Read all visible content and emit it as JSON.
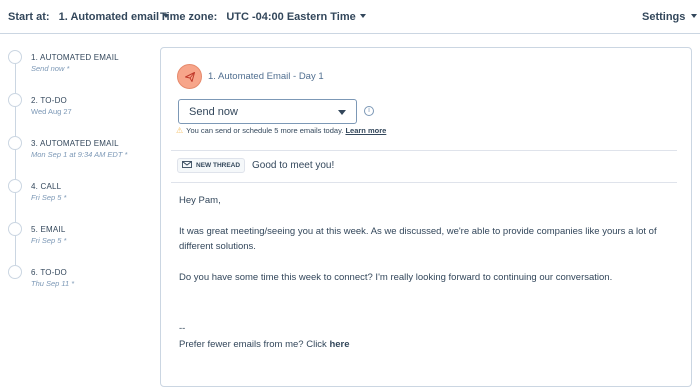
{
  "topbar": {
    "start_at_label": "Start at:",
    "start_at_value": "1. Automated email",
    "timezone_label": "Time zone:",
    "timezone_value": "UTC -04:00 Eastern Time",
    "settings_label": "Settings"
  },
  "steps": [
    {
      "title": "1. AUTOMATED EMAIL",
      "subtitle": "Send now *"
    },
    {
      "title": "2. TO-DO",
      "subtitle": "Wed Aug 27"
    },
    {
      "title": "3. AUTOMATED EMAIL",
      "subtitle": "Mon Sep 1 at 9:34 AM EDT *"
    },
    {
      "title": "4. CALL",
      "subtitle": "Fri Sep 5 *"
    },
    {
      "title": "5. EMAIL",
      "subtitle": "Fri Sep 5 *"
    },
    {
      "title": "6. TO-DO",
      "subtitle": "Thu Sep 11 *"
    }
  ],
  "card": {
    "title": "1. Automated Email - Day 1",
    "send_option": "Send now",
    "warning_text": "You can send or schedule 5 more emails today.",
    "learn_more": "Learn more",
    "thread_badge": "NEW THREAD",
    "subject": "Good to meet you!",
    "greeting": "Hey Pam,",
    "paragraph1": "It was great meeting/seeing you at  this week. As we discussed, we're able to provide companies like yours a lot of different solutions.",
    "paragraph2": "Do you have some time this week to connect? I'm really looking forward to continuing our conversation.",
    "signoff": "--",
    "unsubscribe_text": "Prefer fewer emails from me? Click",
    "unsubscribe_link": "here"
  },
  "icons": {
    "send": "paper-plane-icon",
    "info": "info-icon",
    "warning": "warning-icon",
    "email": "envelope-icon"
  },
  "colors": {
    "accent": "#f7a58a",
    "text": "#33475b",
    "muted": "#7c98b6",
    "warning": "#f5c26b"
  }
}
